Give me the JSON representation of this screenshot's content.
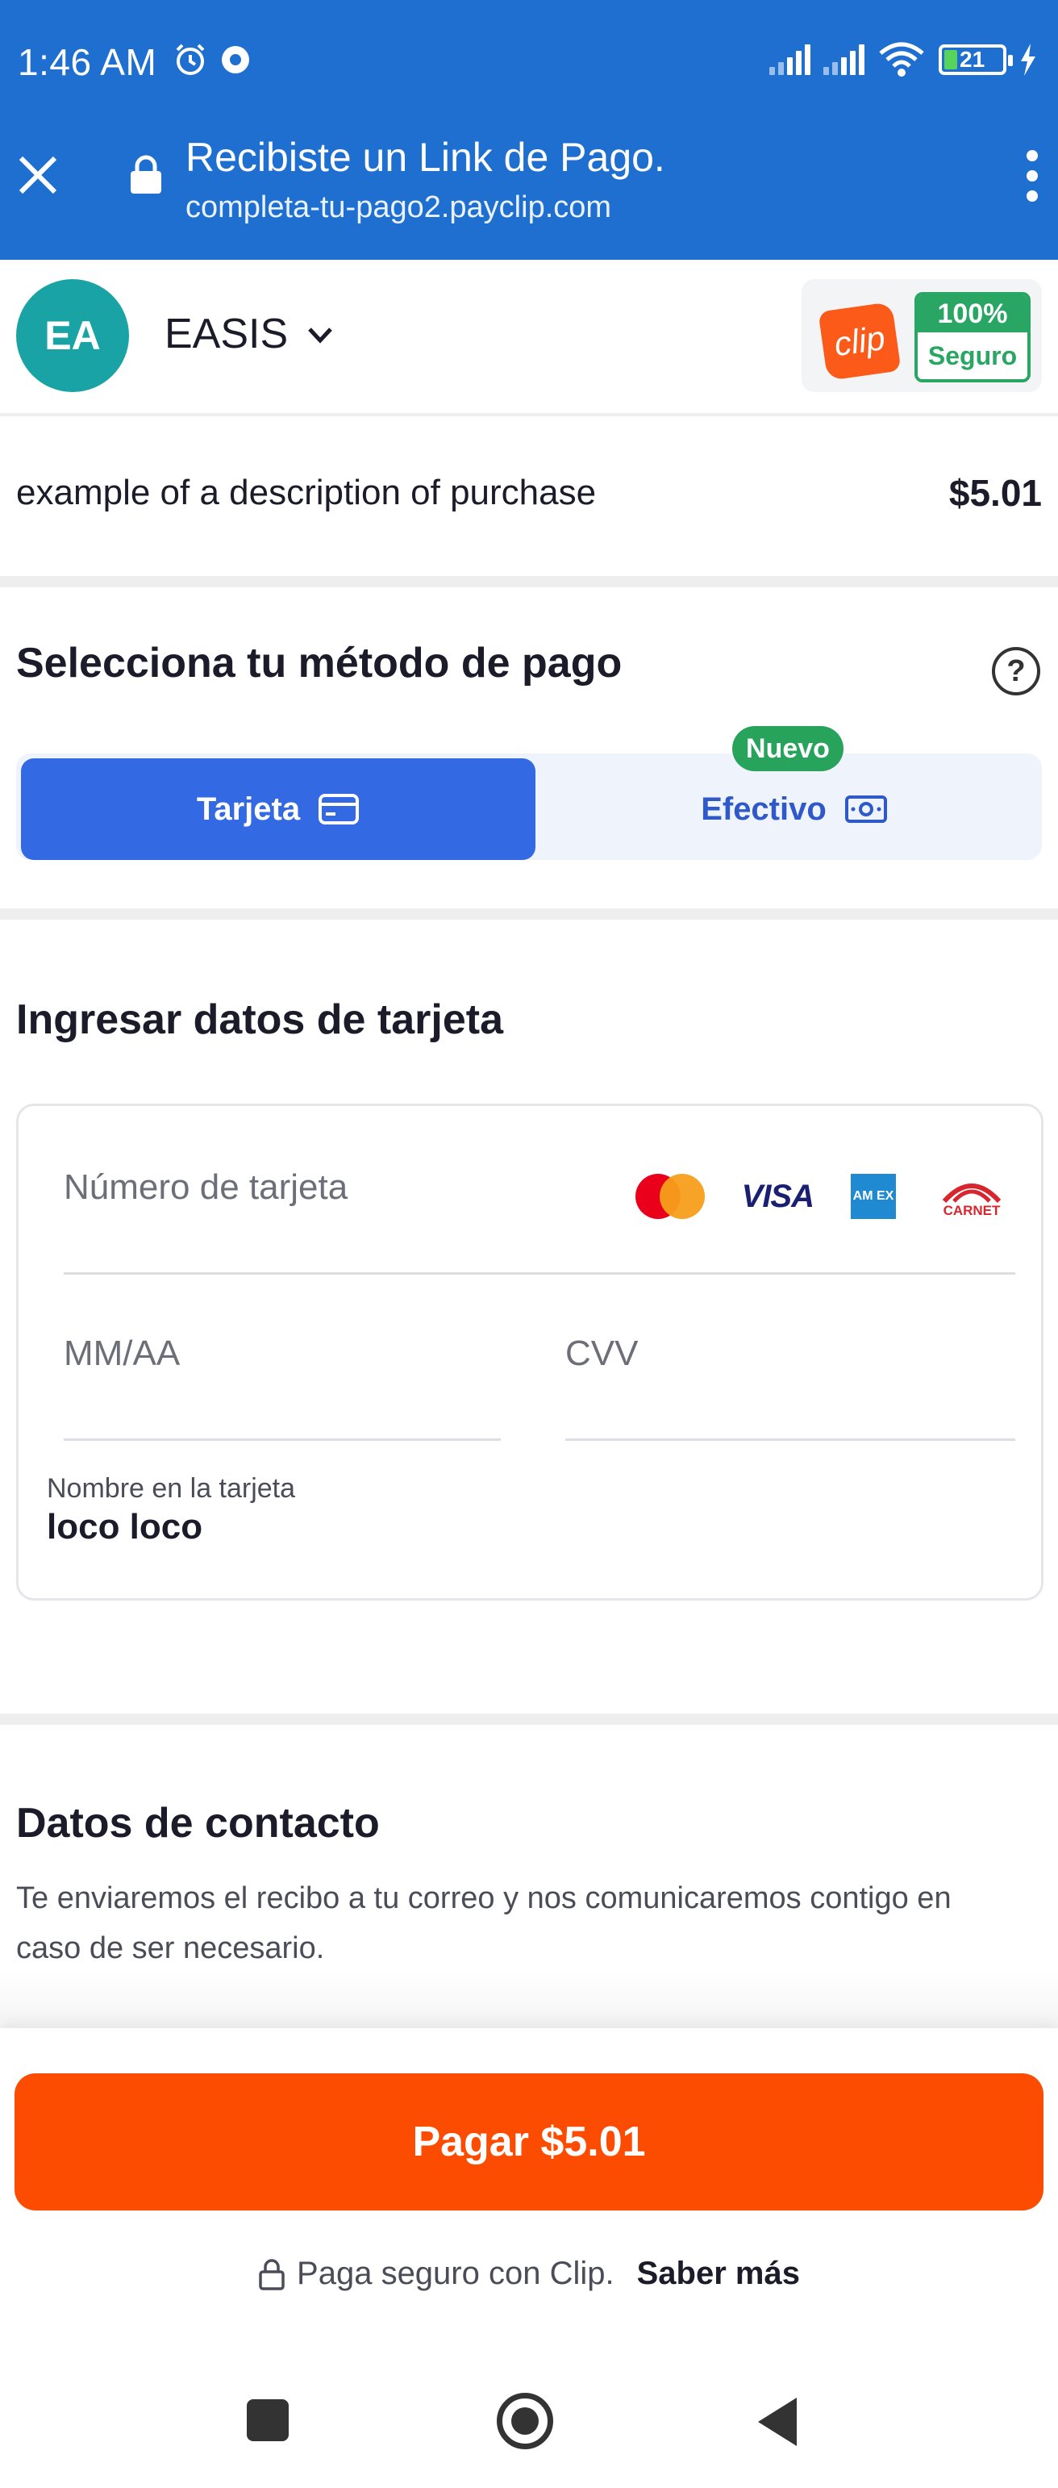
{
  "status_bar": {
    "time": "1:46 AM",
    "battery": "21"
  },
  "browser": {
    "title": "Recibiste un Link de Pago.",
    "url": "completa-tu-pago2.payclip.com"
  },
  "merchant": {
    "initials": "EA",
    "name": "EASIS",
    "logo_text": "clip",
    "seal_top": "100%",
    "seal_bottom": "Seguro"
  },
  "purchase": {
    "description": "example of a description of purchase",
    "amount": "$5.01"
  },
  "payment_method": {
    "title": "Selecciona tu método de pago",
    "help": "?",
    "tabs": [
      {
        "label": "Tarjeta",
        "selected": true
      },
      {
        "label": "Efectivo",
        "selected": false
      }
    ],
    "new_badge": "Nuevo"
  },
  "card": {
    "title": "Ingresar datos de tarjeta",
    "number_placeholder": "Número de tarjeta",
    "expiry_placeholder": "MM/AA",
    "cvv_placeholder": "CVV",
    "name_label": "Nombre en la tarjeta",
    "name_value": "loco loco",
    "brands": {
      "visa": "VISA",
      "amex": "AM EX",
      "carnet": "CARNET"
    }
  },
  "contact": {
    "title": "Datos de contacto",
    "description": "Te enviaremos el recibo a tu correo y nos comunicaremos contigo en caso de ser necesario."
  },
  "footer": {
    "pay_button": "Pagar $5.01",
    "secure_text": "Paga seguro con Clip.",
    "learn_more": "Saber más"
  },
  "colors": {
    "browser_bar": "#1f6fd1",
    "avatar": "#1aa3a5",
    "selected_tab": "#3469e4",
    "pay_button": "#fc4c02",
    "seal_green": "#29a564"
  }
}
